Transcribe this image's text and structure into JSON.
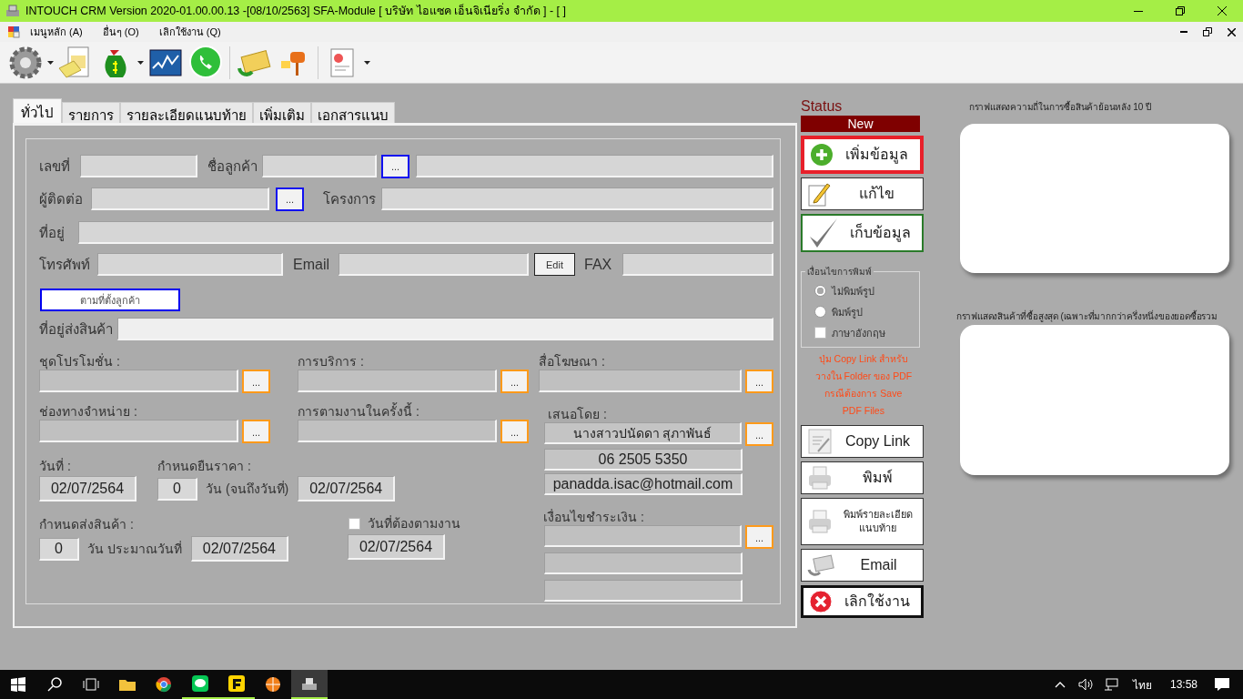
{
  "window": {
    "title": "INTOUCH CRM Version 2020-01.00.00.13 -[08/10/2563] SFA-Module  [ บริษัท ไอแซค เอ็นจิเนียริ่ง จำกัด ] - [ ]"
  },
  "menu": [
    "เมนูหลัก (A)",
    "อื่นๆ (O)",
    "เลิกใช้งาน (Q)"
  ],
  "tabs": [
    {
      "label": "ทั่วไป",
      "selected": true
    },
    {
      "label": "รายการ",
      "selected": false
    },
    {
      "label": "รายละเอียดแนบท้าย",
      "selected": false
    },
    {
      "label": "เพิ่มเติม",
      "selected": false
    },
    {
      "label": "เอกสารแนบ",
      "selected": false
    }
  ],
  "form": {
    "doc_no": {
      "label": "เลขที่"
    },
    "customer": {
      "label": "ชื่อลูกค้า",
      "button": "..."
    },
    "contact": {
      "label": "ผู้ติดต่อ",
      "button": "..."
    },
    "project": {
      "label": "โครงการ"
    },
    "address": {
      "label": "ที่อยู่"
    },
    "phone": {
      "label": "โทรศัพท์"
    },
    "email": {
      "label": "Email",
      "button": "Edit"
    },
    "fax": {
      "label": "FAX"
    },
    "location_button": "ตามที่ตั้งลูกค้า",
    "shipping_address": {
      "label": "ที่อยู่ส่งสินค้า"
    },
    "promotion": {
      "label": "ชุดโปรโมชั่น :",
      "button": "..."
    },
    "service": {
      "label": "การบริการ :",
      "button": "..."
    },
    "media": {
      "label": "สื่อโฆษณา :",
      "button": "..."
    },
    "channel": {
      "label": "ช่องทางจำหน่าย  :",
      "button": "..."
    },
    "follow_up": {
      "label": "การตามงานในครั้งนี้ :",
      "button": "..."
    },
    "proposed_by": {
      "label": "เสนอโดย :",
      "button": "...",
      "values": [
        "นางสาวปนัดดา สุภาพันธ์",
        "06 2505 5350",
        "panadda.isac@hotmail.com"
      ]
    },
    "date": {
      "label": "วันที่ :",
      "value": "02/07/2564"
    },
    "price_valid": {
      "label": "กำหนดยืนราคา :",
      "days": "0",
      "unit": "วัน (จนถึงวันที่)",
      "until": "02/07/2564"
    },
    "delivery": {
      "label": "กำหนดส่งสินค้า :",
      "days": "0",
      "unit": "วัน ประมาณวันที่",
      "date": "02/07/2564"
    },
    "follow_date": {
      "label": "วันที่ต้องตามงาน",
      "checked": false,
      "value": "02/07/2564"
    },
    "payment_terms": {
      "label": "เงื่อนไขชำระเงิน :",
      "button": "..."
    }
  },
  "status": {
    "label": "Status",
    "value": "New"
  },
  "actions_top": [
    {
      "kind": "add",
      "label": "เพิ่มข้อมูล",
      "highlighted": true
    },
    {
      "kind": "edit",
      "label": "แก้ไข",
      "highlighted": false
    },
    {
      "kind": "save",
      "label": "เก็บข้อมูล",
      "highlighted": false
    }
  ],
  "print_options": {
    "title": "เงื่อนไขการพิมพ์",
    "radios": [
      {
        "label": "ไม่พิมพ์รูป",
        "selected": true
      },
      {
        "label": "พิมพ์รูป",
        "selected": false
      }
    ],
    "english": {
      "label": "ภาษาอังกฤษ",
      "checked": false
    }
  },
  "note": [
    "ปุ่ม Copy Link สำหรับ",
    "วางใน Folder ของ PDF",
    "กรณีต้องการ Save",
    "PDF Files"
  ],
  "actions_bottom": [
    {
      "kind": "copy",
      "label": "Copy Link",
      "highlighted": false
    },
    {
      "kind": "print",
      "label": "พิมพ์",
      "highlighted": false
    },
    {
      "kind": "print_detail",
      "label": "พิมพ์รายละเอียดแนบท้าย",
      "highlighted": false
    },
    {
      "kind": "email",
      "label": "Email",
      "highlighted": false
    },
    {
      "kind": "cancel",
      "label": "เลิกใช้งาน",
      "highlighted": false
    }
  ],
  "charts": [
    {
      "caption": "กราฟแสดงความถี่ในการซื้อสินค้าย้อนหลัง 10 ปี"
    },
    {
      "caption": "กราฟแสดงสินค้าที่ซื้อสูงสุด (เฉพาะที่มากกว่าครึ่งหนึ่งของยอดซื้อรวม"
    }
  ],
  "taskbar": {
    "language": "ไทย",
    "time": "13:58"
  }
}
